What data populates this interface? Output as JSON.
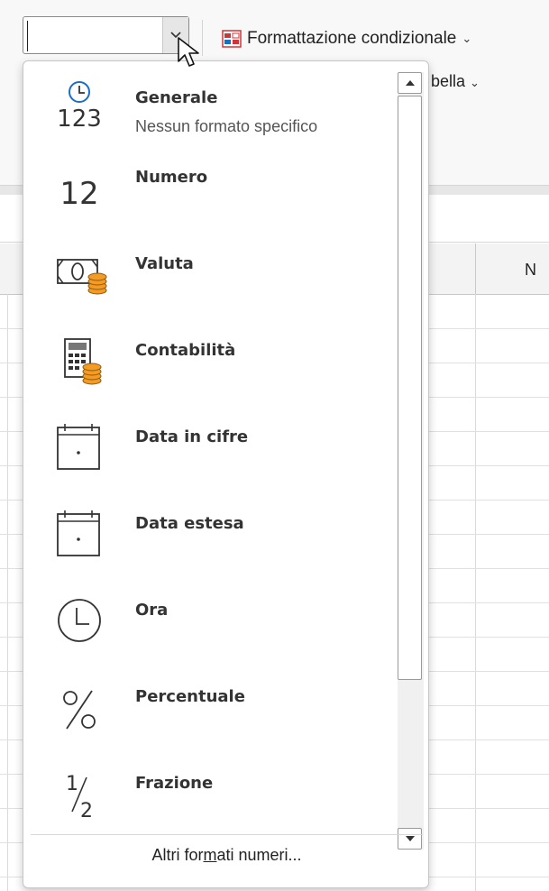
{
  "ribbon": {
    "conditional_formatting_label": "Formattazione condizionale",
    "format_as_table_label_partial": "bella",
    "column_label": "N"
  },
  "combo": {
    "value": ""
  },
  "menu": {
    "items": [
      {
        "title": "Generale",
        "subtitle": "Nessun formato specifico",
        "icon": "general-clock-123-icon"
      },
      {
        "title": "Numero",
        "icon": "number-12-icon"
      },
      {
        "title": "Valuta",
        "icon": "currency-banknote-coins-icon"
      },
      {
        "title": "Contabilità",
        "icon": "accounting-calculator-coins-icon"
      },
      {
        "title": "Data in cifre",
        "icon": "calendar-short-date-icon"
      },
      {
        "title": "Data estesa",
        "icon": "calendar-long-date-icon"
      },
      {
        "title": "Ora",
        "icon": "clock-icon"
      },
      {
        "title": "Percentuale",
        "icon": "percent-icon"
      },
      {
        "title": "Frazione",
        "icon": "fraction-half-icon"
      }
    ],
    "more_formats": {
      "before": "Altri for",
      "underlined": "m",
      "after": "ati numeri..."
    }
  },
  "colors": {
    "accent_blue": "#1a6fc4",
    "coin_orange": "#f59a23",
    "red_icon": "#d13438"
  }
}
